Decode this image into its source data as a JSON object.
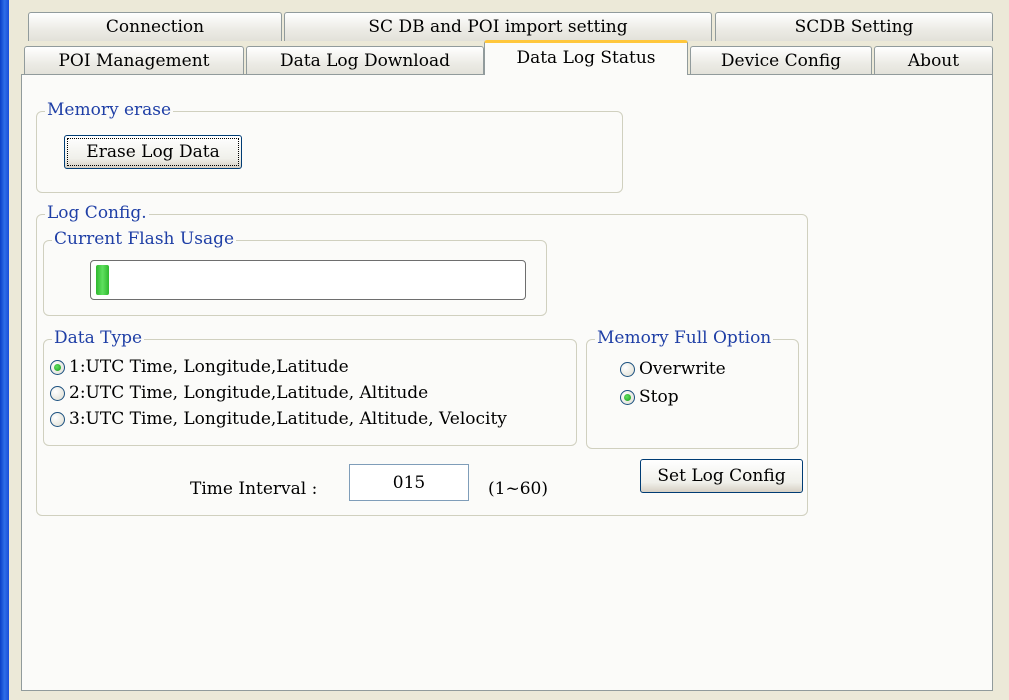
{
  "tabs_row1": [
    {
      "label": "Connection"
    },
    {
      "label": "SC DB and POI import setting"
    },
    {
      "label": "SCDB  Setting"
    }
  ],
  "tabs_row2": [
    {
      "label": "POI Management"
    },
    {
      "label": "Data Log Download"
    },
    {
      "label": "Data Log Status"
    },
    {
      "label": "Device Config"
    },
    {
      "label": "About"
    }
  ],
  "active_tab": "Data Log Status",
  "memory_erase": {
    "legend": "Memory erase",
    "erase_button": "Erase Log Data"
  },
  "log_config": {
    "legend": "Log Config.",
    "flash_usage": {
      "legend": "Current Flash Usage",
      "progress_percent": 3
    },
    "data_type": {
      "legend": "Data Type",
      "options": [
        {
          "label": "1:UTC Time, Longitude,Latitude",
          "checked": true
        },
        {
          "label": "2:UTC Time, Longitude,Latitude, Altitude",
          "checked": false
        },
        {
          "label": "3:UTC Time, Longitude,Latitude, Altitude, Velocity",
          "checked": false
        }
      ]
    },
    "memory_full": {
      "legend": "Memory Full Option",
      "options": [
        {
          "label": "Overwrite",
          "checked": false
        },
        {
          "label": "Stop",
          "checked": true
        }
      ]
    },
    "time_interval": {
      "label": "Time Interval :",
      "value": "015",
      "range": "(1~60)"
    },
    "set_button": "Set Log Config"
  },
  "colors": {
    "legend_text": "#1f3fa6",
    "active_tab_accent": "#ffc73c",
    "progress_green": "#2fb82f",
    "window_frame_blue": "#0a3fc7"
  }
}
